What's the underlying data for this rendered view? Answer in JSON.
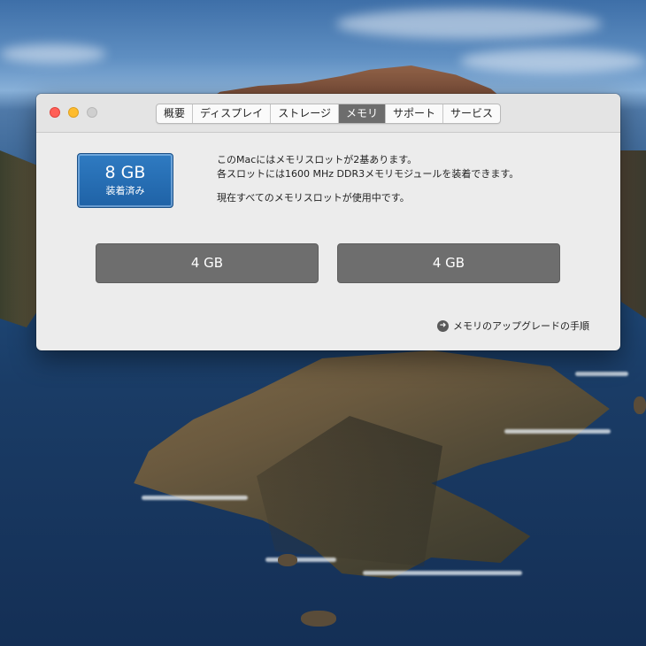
{
  "window": {
    "tabs": [
      {
        "label": "概要"
      },
      {
        "label": "ディスプレイ"
      },
      {
        "label": "ストレージ"
      },
      {
        "label": "メモリ"
      },
      {
        "label": "サポート"
      },
      {
        "label": "サービス"
      }
    ],
    "active_tab": "メモリ"
  },
  "memory": {
    "total_size": "8 GB",
    "total_status": "装着済み",
    "info_line1": "このMacにはメモリスロットが2基あります。",
    "info_line2": "各スロットには1600 MHz DDR3メモリモジュールを装着できます。",
    "info_line3": "現在すべてのメモリスロットが使用中です。",
    "slots": [
      {
        "size": "4 GB"
      },
      {
        "size": "4 GB"
      }
    ],
    "upgrade_link": "メモリのアップグレードの手順"
  },
  "colors": {
    "active_tab": "#6d6d6d",
    "badge_blue": "#1f62a6",
    "slot_gray": "#6e6e6e",
    "close": "#ff5f57",
    "minimize": "#febc2e"
  },
  "icons": {
    "upgrade_link_icon": "arrow-right-circle-icon"
  }
}
